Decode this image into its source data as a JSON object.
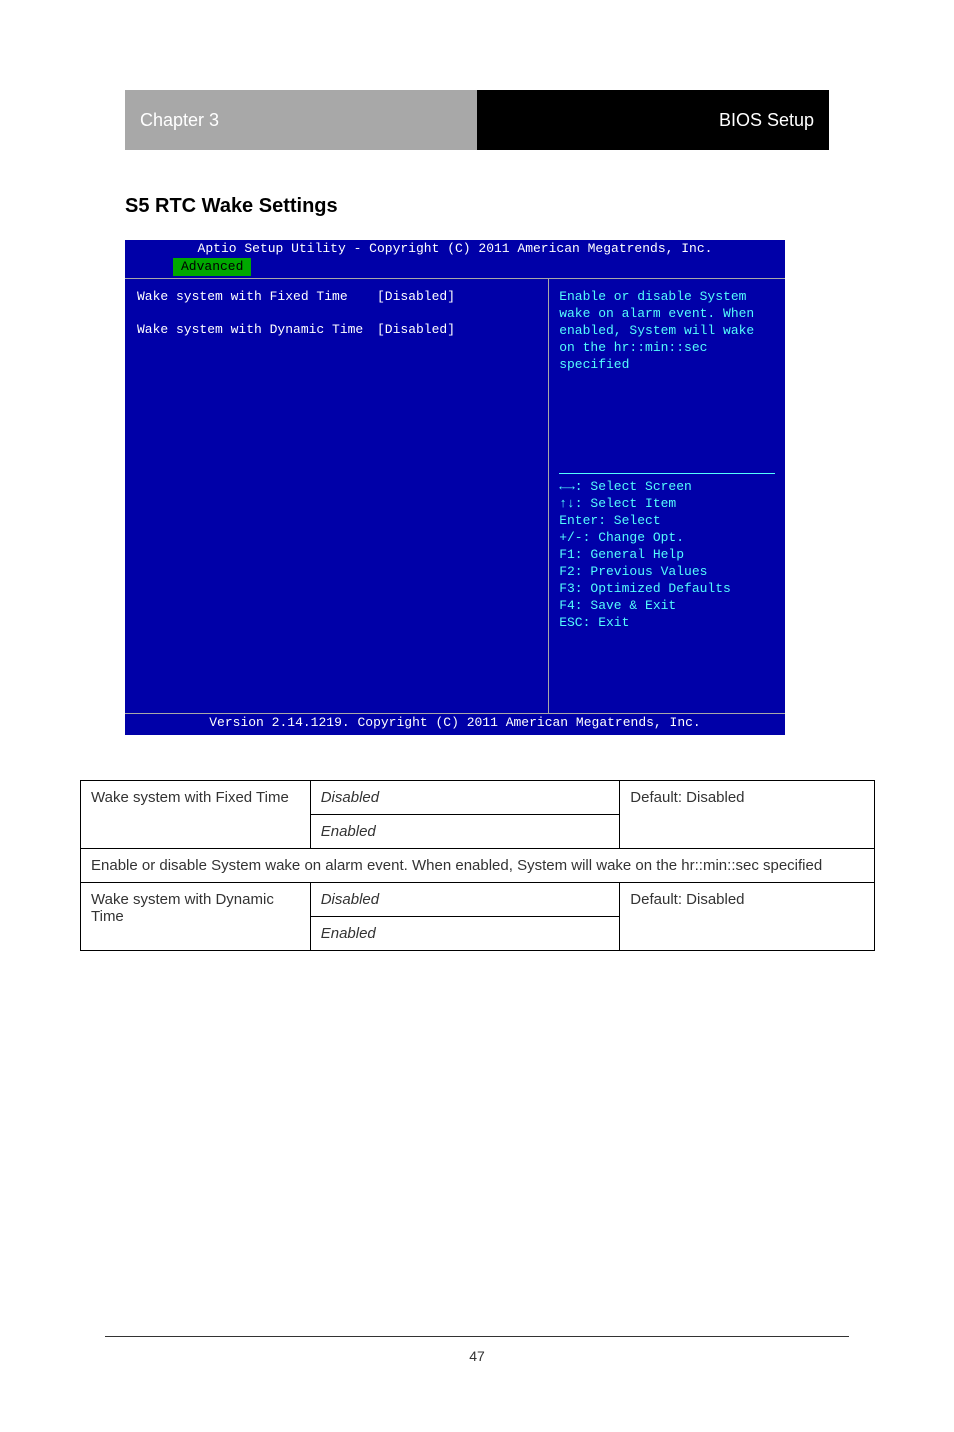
{
  "page": {
    "header_left": "Chapter 3",
    "header_right": "BIOS Setup",
    "section_title": "S5 RTC Wake Settings",
    "page_number": "47"
  },
  "bios": {
    "title_bar": "Aptio Setup Utility - Copyright (C) 2011 American Megatrends, Inc.",
    "active_tab": "Advanced",
    "rows": [
      {
        "label": "Wake system with Fixed Time",
        "value": "[Disabled]"
      },
      {
        "label": "Wake system with Dynamic Time",
        "value": "[Disabled]"
      }
    ],
    "help_text": "Enable or disable System wake on alarm event. When enabled, System will wake on the hr::min::sec specified",
    "keyhelp": [
      "←→: Select Screen",
      "↑↓: Select Item",
      "Enter: Select",
      "+/-: Change Opt.",
      "F1: General Help",
      "F2: Previous Values",
      "F3: Optimized Defaults",
      "F4: Save & Exit",
      "ESC: Exit"
    ],
    "footer": "Version 2.14.1219. Copyright (C) 2011 American Megatrends, Inc."
  },
  "table": {
    "rows": [
      {
        "type": "option",
        "col1": "Wake system with Fixed Time",
        "col2a": "Disabled",
        "col2b": "Enabled",
        "col3": "Default: Disabled"
      },
      {
        "type": "desc",
        "text": "Enable or disable System wake on alarm event. When enabled, System will wake on the hr::min::sec specified"
      },
      {
        "type": "option",
        "col1": "Wake system with Dynamic Time",
        "col2a": "Disabled",
        "col2b": "Enabled",
        "col3": "Default: Disabled"
      }
    ]
  }
}
